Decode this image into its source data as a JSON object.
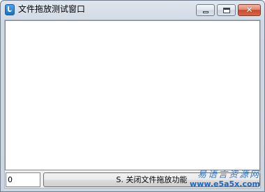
{
  "window": {
    "title": "文件拖放测试窗口",
    "close_glyph": "✕",
    "colors": {
      "frame": "#cdd6df",
      "close_button": "#c9492e",
      "watermark": "#2266c0"
    },
    "icons": [
      "app-icon",
      "minimize-icon",
      "maximize-icon",
      "close-icon"
    ]
  },
  "main": {
    "file_list_text": "",
    "count_value": "0",
    "toggle_button_label": "S. 关闭文件拖放功能"
  },
  "watermark": {
    "brand": "易语言资源网",
    "url": "www.e5a5x.com"
  }
}
